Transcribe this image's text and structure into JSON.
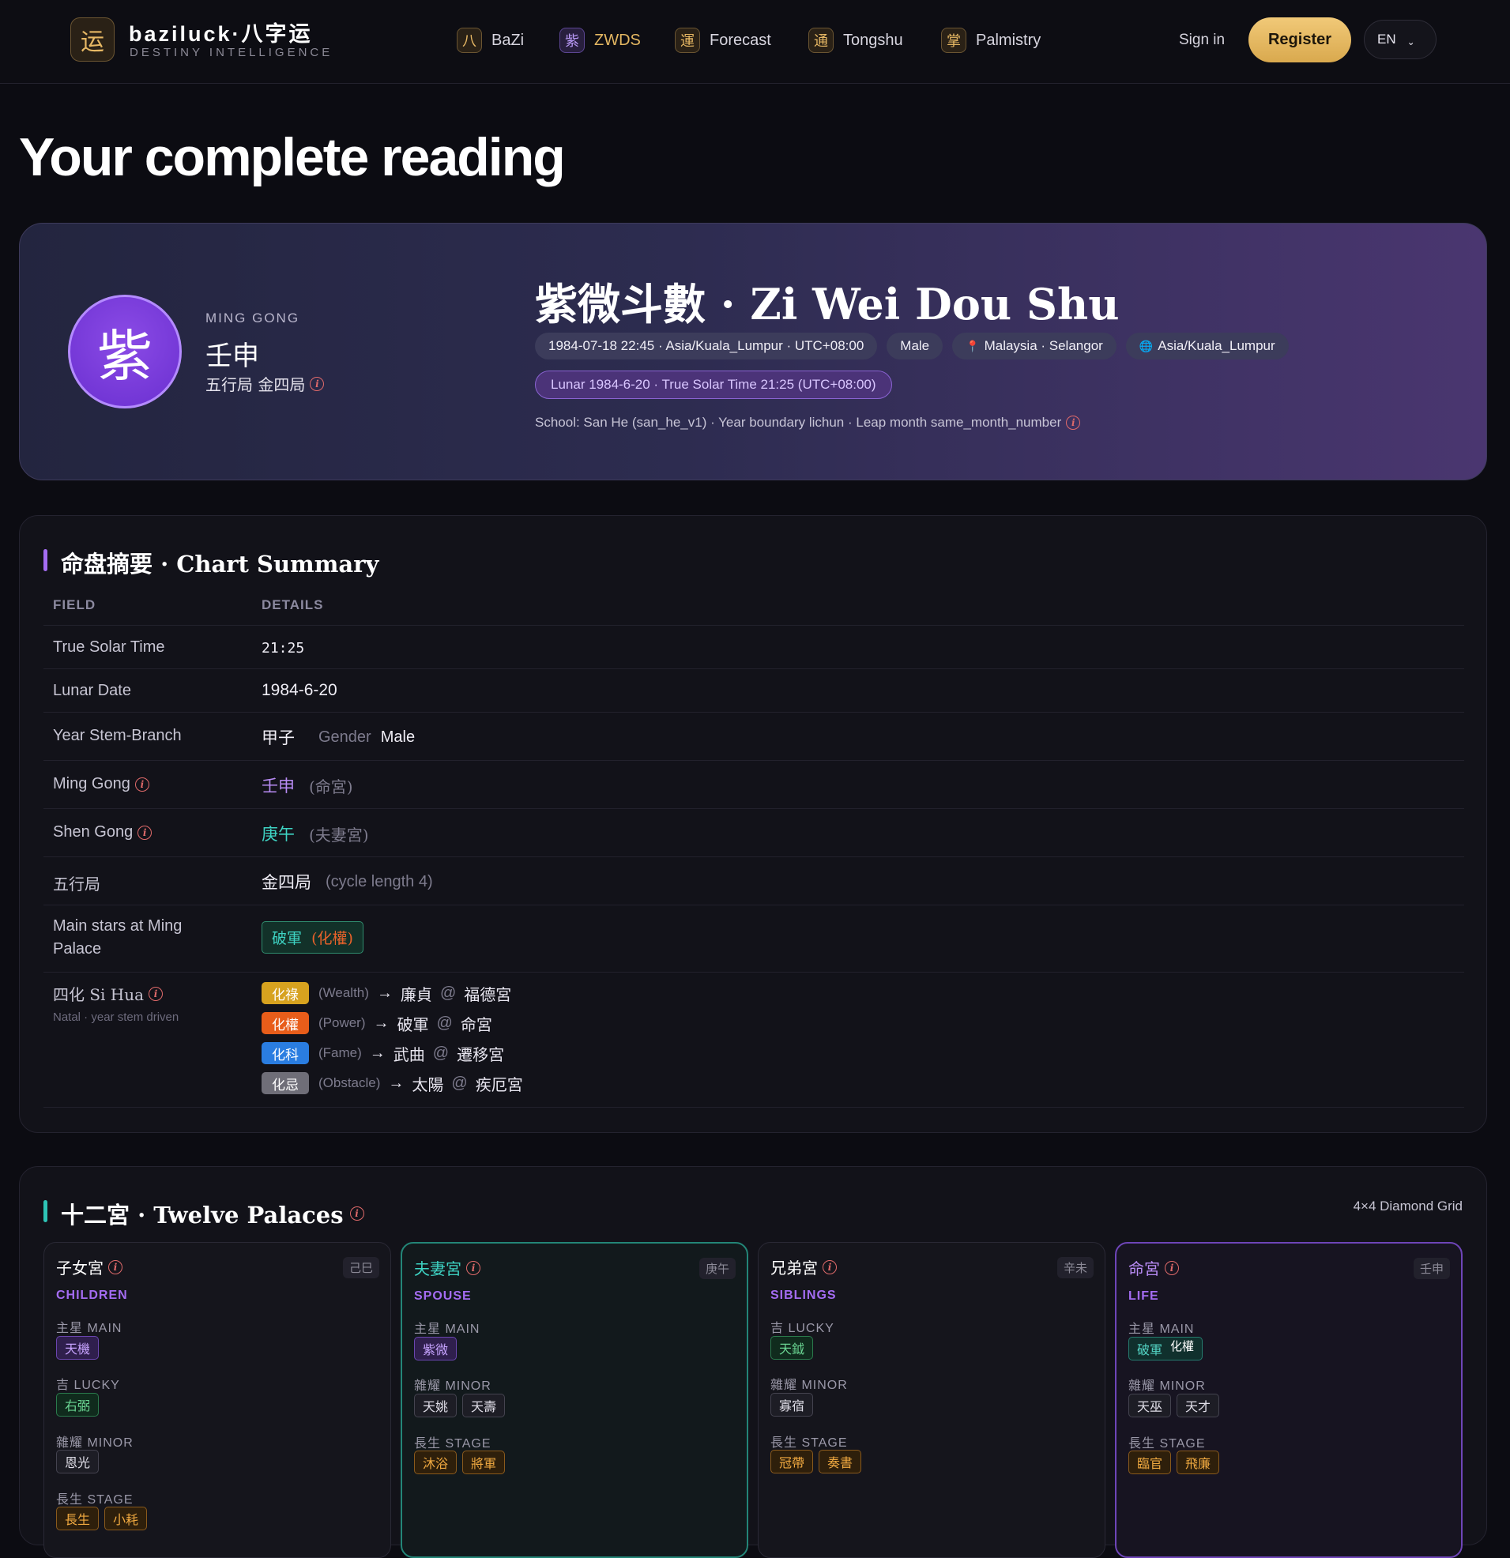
{
  "header": {
    "logo_glyph": "运",
    "brand": "baziluck·八字运",
    "brand_sub": "DESTINY INTELLIGENCE",
    "nav": [
      {
        "glyph": "八",
        "label": "BaZi"
      },
      {
        "glyph": "紫",
        "label": "ZWDS"
      },
      {
        "glyph": "運",
        "label": "Forecast"
      },
      {
        "glyph": "通",
        "label": "Tongshu"
      },
      {
        "glyph": "掌",
        "label": "Palmistry"
      }
    ],
    "signin": "Sign in",
    "register": "Register",
    "lang": "EN",
    "lang_chevron": "⌄"
  },
  "page_title": "Your complete reading",
  "hero": {
    "avatar_glyph": "紫",
    "ming_gong_label": "MING GONG",
    "ming_gong_value": "壬申",
    "element_bureau": "五行局 金四局",
    "title": "紫微斗數 · Zi Wei Dou Shu",
    "chips": [
      "1984-07-18 22:45 · Asia/Kuala_Lumpur · UTC+08:00",
      "Male",
      "Malaysia · Selangor",
      "Asia/Kuala_Lumpur"
    ],
    "lunar_chip": "Lunar 1984-6-20 · True Solar Time 21:25 (UTC+08:00)",
    "school": "School: San He (san_he_v1) · Year boundary lichun · Leap month same_month_number"
  },
  "summary": {
    "title": "命盘摘要 · Chart Summary",
    "col_field": "FIELD",
    "col_details": "DETAILS",
    "true_solar_time": {
      "label": "True Solar Time",
      "value": "21:25"
    },
    "lunar_date": {
      "label": "Lunar Date",
      "value": "1984-6-20"
    },
    "year_stem": {
      "label": "Year Stem-Branch",
      "value": "甲子",
      "gender_label": "Gender",
      "gender": "Male"
    },
    "ming_gong": {
      "label": "Ming Gong",
      "value": "壬申",
      "note": "(命宮)"
    },
    "shen_gong": {
      "label": "Shen Gong",
      "value": "庚午",
      "note": "(夫妻宮)"
    },
    "bureau": {
      "label": "五行局",
      "value": "金四局",
      "note": "(cycle length 4)"
    },
    "main_stars": {
      "label": "Main stars at Ming Palace",
      "star": "破軍",
      "hua": "(化權)"
    },
    "sihua": {
      "label": "四化 Si Hua",
      "sub": "Natal · year stem driven",
      "items": [
        {
          "badge": "化祿",
          "en": "(Wealth)",
          "star": "廉貞",
          "palace": "福德宮",
          "color": "#d7a21f"
        },
        {
          "badge": "化權",
          "en": "(Power)",
          "star": "破軍",
          "palace": "命宮",
          "color": "#e85d1a"
        },
        {
          "badge": "化科",
          "en": "(Fame)",
          "star": "武曲",
          "palace": "遷移宮",
          "color": "#2a7de1"
        },
        {
          "badge": "化忌",
          "en": "(Obstacle)",
          "star": "太陽",
          "palace": "疾厄宮",
          "color": "#6f6e78"
        }
      ]
    }
  },
  "palaces": {
    "title": "十二宮 · Twelve Palaces",
    "grid_note": "4×4 Diamond Grid",
    "labels": {
      "main": "主星 MAIN",
      "lucky": "吉 LUCKY",
      "minor": "雜耀 MINOR",
      "stage": "長生 STAGE"
    },
    "items": [
      {
        "name": "子女宮",
        "en": "CHILDREN",
        "stem": "己巳",
        "main": [
          "天機"
        ],
        "lucky": [
          "右弼"
        ],
        "minor": [
          "恩光"
        ],
        "stage": [
          "長生",
          "小耗"
        ]
      },
      {
        "name": "夫妻宮",
        "en": "SPOUSE",
        "stem": "庚午",
        "main": [
          "紫微"
        ],
        "minor": [
          "天姚",
          "天壽"
        ],
        "stage": [
          "沐浴",
          "將軍"
        ]
      },
      {
        "name": "兄弟宮",
        "en": "SIBLINGS",
        "stem": "辛未",
        "lucky": [
          "天鉞"
        ],
        "minor": [
          "寡宿"
        ],
        "stage": [
          "冠帶",
          "奏書"
        ]
      },
      {
        "name": "命宮",
        "en": "LIFE",
        "stem": "壬申",
        "main": [
          "破軍"
        ],
        "main_hua": "化權",
        "minor": [
          "天巫",
          "天才"
        ],
        "stage": [
          "臨官",
          "飛廉"
        ]
      }
    ]
  },
  "arrow": "→",
  "at": "@",
  "info_glyph": "i"
}
